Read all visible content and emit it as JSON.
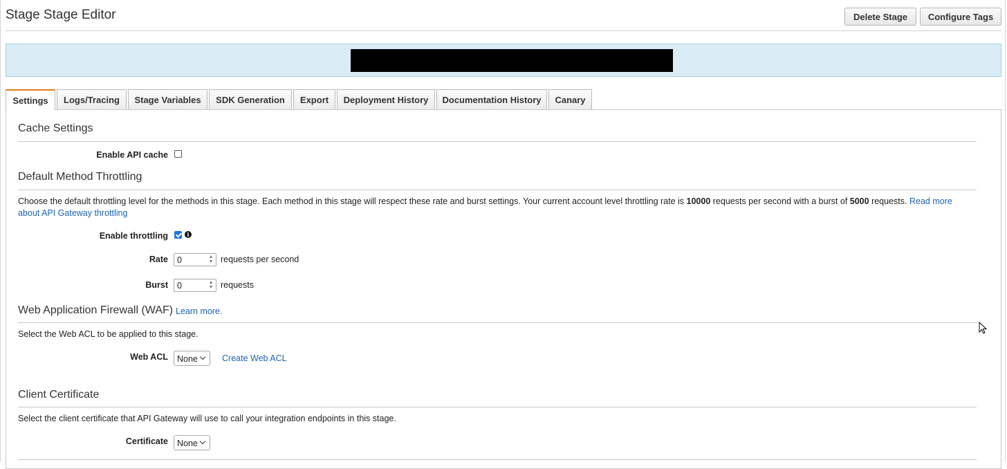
{
  "header": {
    "title": "Stage Stage Editor",
    "delete_label": "Delete Stage",
    "tags_label": "Configure Tags"
  },
  "tabs": [
    {
      "label": "Settings",
      "active": true
    },
    {
      "label": "Logs/Tracing"
    },
    {
      "label": "Stage Variables"
    },
    {
      "label": "SDK Generation"
    },
    {
      "label": "Export"
    },
    {
      "label": "Deployment History"
    },
    {
      "label": "Documentation History"
    },
    {
      "label": "Canary"
    }
  ],
  "cache": {
    "title": "Cache Settings",
    "enable_label": "Enable API cache",
    "enabled": false
  },
  "throttling": {
    "title": "Default Method Throttling",
    "desc_part1": "Choose the default throttling level for the methods in this stage. Each method in this stage will respect these rate and burst settings. Your current account level throttling rate is ",
    "rate_limit": "10000",
    "desc_part2": " requests per second with a burst of ",
    "burst_limit": "5000",
    "desc_part3": " requests. ",
    "read_more": "Read more about API Gateway throttling",
    "enable_label": "Enable throttling",
    "enabled": true,
    "rate_label": "Rate",
    "rate_value": "0",
    "rate_unit": "requests per second",
    "burst_label": "Burst",
    "burst_value": "0",
    "burst_unit": "requests"
  },
  "waf": {
    "title": "Web Application Firewall (WAF)",
    "learn_more": "Learn more.",
    "desc": "Select the Web ACL to be applied to this stage.",
    "acl_label": "Web ACL",
    "acl_value": "None",
    "create_link": "Create Web ACL"
  },
  "certificate": {
    "title": "Client Certificate",
    "desc": "Select the client certificate that API Gateway will use to call your integration endpoints in this stage.",
    "label": "Certificate",
    "value": "None"
  },
  "icons": {
    "info": "info-icon",
    "cursor": "mouse-pointer-icon"
  }
}
